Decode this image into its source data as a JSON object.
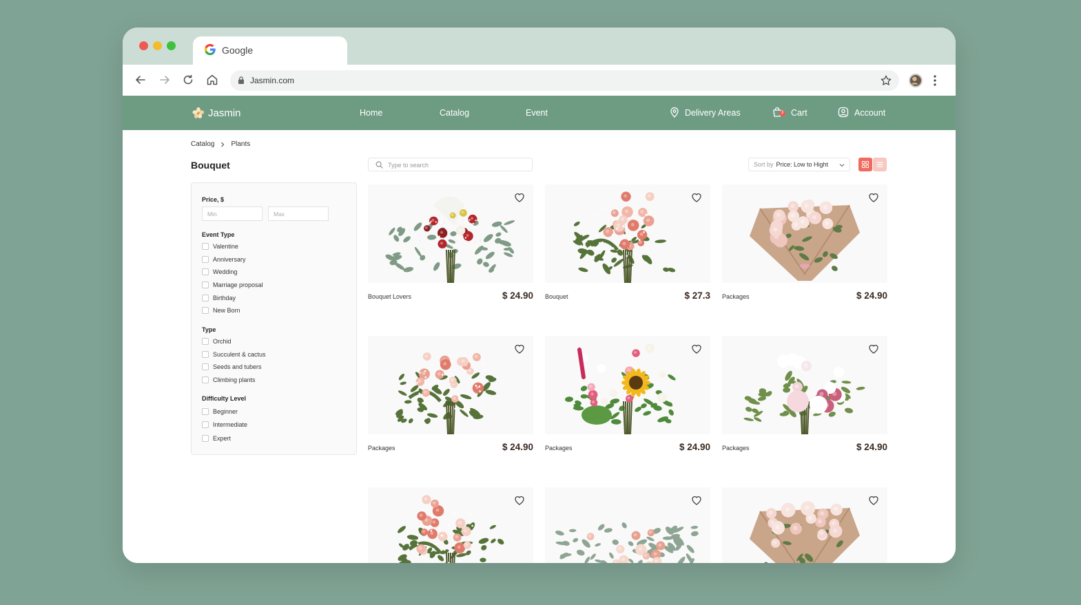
{
  "browser": {
    "tab_title": "Google",
    "url": "Jasmin.com"
  },
  "site": {
    "brand": "Jasmin",
    "nav": {
      "home": "Home",
      "catalog": "Catalog",
      "event": "Event",
      "delivery": "Delivery Areas",
      "cart": "Cart",
      "cart_count": "3",
      "account": "Account"
    }
  },
  "breadcrumb": [
    "Catalog",
    "Plants"
  ],
  "page_title": "Bouquet",
  "search": {
    "placeholder": "Type to search"
  },
  "sort": {
    "label": "Sort by",
    "value": "Price: Low to Hight"
  },
  "filters": {
    "price": {
      "title": "Price, $",
      "min_placeholder": "Min",
      "max_placeholder": "Max"
    },
    "event_type": {
      "title": "Event Type",
      "options": [
        "Valentine",
        "Anniversary",
        "Wedding",
        "Marriage proposal",
        "Birthday",
        "New Born"
      ]
    },
    "type": {
      "title": "Type",
      "options": [
        "Orchid",
        "Succulent & cactus",
        "Seeds and tubers",
        "Climbing plants"
      ]
    },
    "difficulty": {
      "title": "Difficulty Level",
      "options": [
        "Beginner",
        "Intermediate",
        "Expert"
      ]
    }
  },
  "products": [
    {
      "category": "Bouquet Lovers",
      "price": "$ 24.90",
      "style": "mixed-red"
    },
    {
      "category": "Bouquet",
      "price": "$ 27.3",
      "style": "pink-fern"
    },
    {
      "category": "Packages",
      "price": "$ 24.90",
      "style": "wrapped-roses"
    },
    {
      "category": "Packages",
      "price": "$ 24.90",
      "style": "pink-fern"
    },
    {
      "category": "Packages",
      "price": "$ 24.90",
      "style": "sunflower"
    },
    {
      "category": "Packages",
      "price": "$ 24.90",
      "style": "peony"
    },
    {
      "category": "",
      "price": "",
      "style": "pink-fern"
    },
    {
      "category": "",
      "price": "",
      "style": "eucalyptus"
    },
    {
      "category": "",
      "price": "",
      "style": "wrapped-roses"
    }
  ],
  "colors": {
    "background": "#7fa394",
    "tabbar": "#ccddd6",
    "site_nav": "#6e9c83",
    "accent": "#ef6b5e",
    "price_text": "#3a2a22"
  }
}
